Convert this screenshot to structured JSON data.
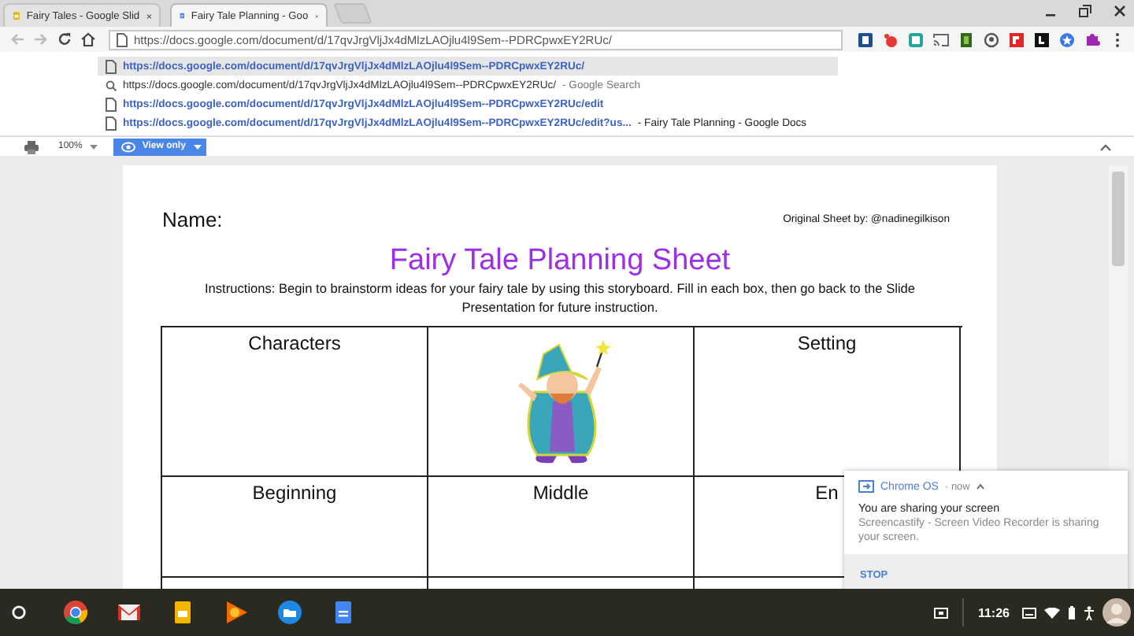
{
  "tabs": [
    {
      "title": "Fairy Tales - Google Slid",
      "selected": false
    },
    {
      "title": "Fairy Tale Planning - Goo",
      "selected": true
    }
  ],
  "address_bar": {
    "value": "https://docs.google.com/document/d/17qvJrgVljJx4dMlzLAOjlu4l9Sem--PDRCpwxEY2RUc/"
  },
  "suggestions": [
    {
      "kind": "page",
      "text": "https://docs.google.com/document/d/17qvJrgVljJx4dMlzLAOjlu4l9Sem--PDRCpwxEY2RUc/",
      "selected": true
    },
    {
      "kind": "search",
      "text": "https://docs.google.com/document/d/17qvJrgVljJx4dMlzLAOjlu4l9Sem--PDRCpwxEY2RUc/",
      "description": "- Google Search",
      "selected": false
    },
    {
      "kind": "page",
      "text": "https://docs.google.com/document/d/17qvJrgVljJx4dMlzLAOjlu4l9Sem--PDRCpwxEY2RUc/edit",
      "selected": false
    },
    {
      "kind": "page",
      "text": "https://docs.google.com/document/d/17qvJrgVljJx4dMlzLAOjlu4l9Sem--PDRCpwxEY2RUc/edit?us...",
      "description": "- Fairy Tale Planning - Google Docs",
      "selected": false
    }
  ],
  "docs_toolbar": {
    "zoom": "100%",
    "mode_button": "View only"
  },
  "document": {
    "name_label": "Name:",
    "credit": "Original Sheet by: @nadinegilkison",
    "title": "Fairy Tale Planning Sheet",
    "instructions": "Instructions: Begin to brainstorm ideas for your fairy tale by using this storyboard. Fill in each box, then go back to the Slide Presentation for future instruction.",
    "table": {
      "rows": [
        [
          {
            "kind": "text",
            "text": "Characters"
          },
          {
            "kind": "image"
          },
          {
            "kind": "text",
            "text": "Setting"
          }
        ],
        [
          {
            "kind": "text",
            "text": "Beginning"
          },
          {
            "kind": "text",
            "text": "Middle"
          },
          {
            "kind": "text",
            "text": "En"
          }
        ]
      ]
    }
  },
  "notification": {
    "source": "Chrome OS",
    "time": "· now",
    "title": "You are sharing your screen",
    "body": "Screencastify - Screen Video Recorder is sharing your screen.",
    "action": "STOP"
  },
  "shelf": {
    "clock": "11:26"
  }
}
